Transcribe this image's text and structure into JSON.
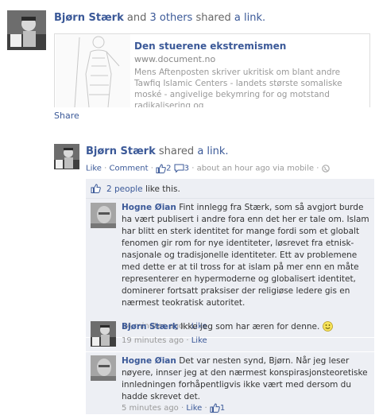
{
  "story1": {
    "actor": "Bjørn Stærk",
    "and_text": "and",
    "others": "3 others",
    "action_text": "shared",
    "object": "a link.",
    "link_card": {
      "title": "Den stuerene ekstremismen",
      "domain": "www.document.no",
      "description": "Mens Aftenposten skriver ukritisk om blant andre Tawfiq Islamic Centers - landets største somaliske moské - angivelige bekymring for og motstand radikalisering og"
    },
    "share_label": "Share"
  },
  "story2": {
    "actor": "Bjørn Stærk",
    "action_text": "shared",
    "object": "a link.",
    "meta": {
      "like_label": "Like",
      "comment_label": "Comment",
      "like_count": "2",
      "comment_count": "3",
      "timestamp": "about an hour ago via mobile"
    },
    "likes_summary": {
      "people": "2 people",
      "suffix": "like this."
    },
    "comments": [
      {
        "author": "Hogne Øian",
        "text": "Fint innlegg fra Stærk, som så avgjort burde ha vært publisert i andre fora enn det her er tale om. Islam har blitt en sterk identitet for mange fordi som et globalt fenomen gir rom for nye identiteter, løsrevet fra etnisk-nasjonale og tradisjonelle identiteter. Ett av problemene med dette er at til tross for at islam på mer enn en måte representerer en hypermoderne og globalisert identitet, dominerer fortsatt praksiser der religiøse ledere gis en nærmest teokratisk autoritet.",
        "time": "54 minutes ago",
        "like_label": "Like"
      },
      {
        "author": "Bjørn Stærk",
        "text": "Ikke jeg som har æren for denne.",
        "time": "19 minutes ago",
        "like_label": "Like"
      },
      {
        "author": "Hogne Øian",
        "text": "Det var nesten synd, Bjørn. Når jeg leser nøyere, innser jeg at den nærmest konspirasjonsteoretiske innledningen forhåpentligvis ikke vært med dersom du hadde skrevet det.",
        "time": "5 minutes ago",
        "like_label": "Like",
        "like_count": "1"
      }
    ]
  },
  "colors": {
    "link": "#3b5998",
    "ufi_bg": "#edeff4",
    "muted": "#999999"
  },
  "icons": [
    "thumbs-up-icon",
    "comment-bubble-icon",
    "globe-icon",
    "smiley-icon"
  ]
}
